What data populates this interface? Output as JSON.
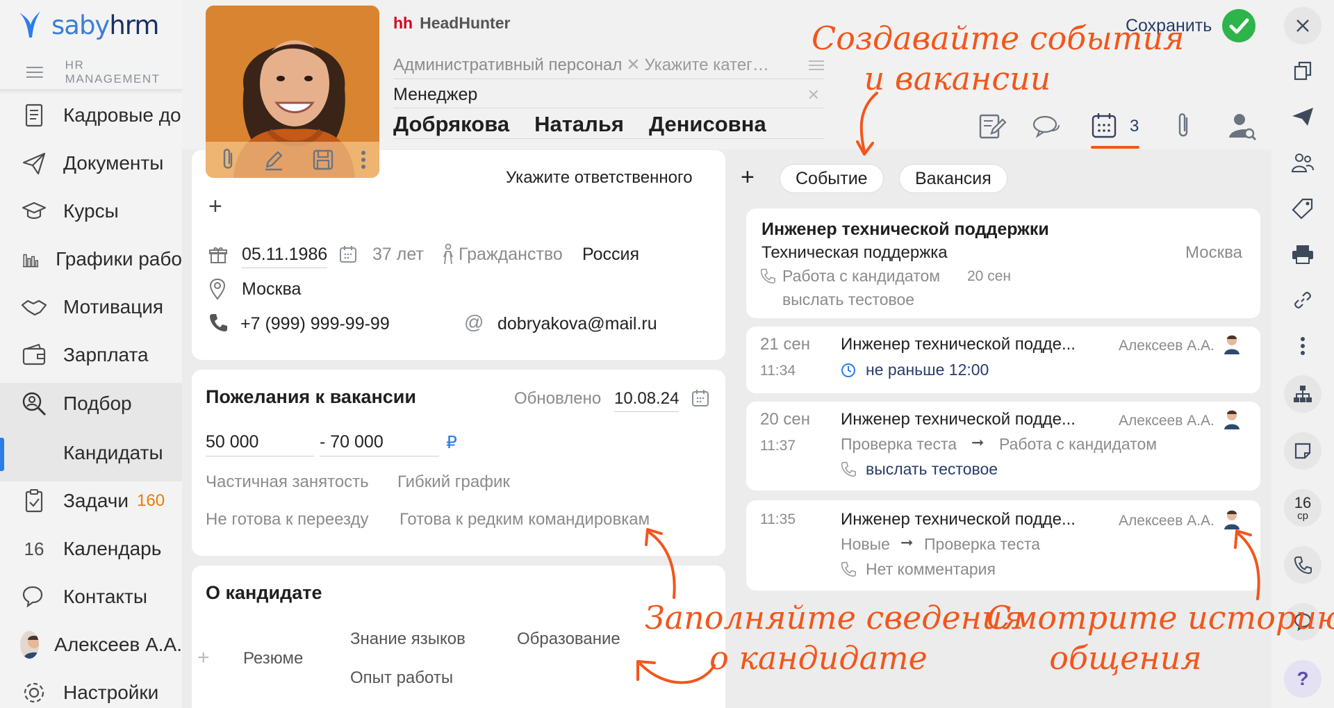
{
  "sidebar": {
    "logo_text_saby": "saby",
    "logo_text_hrm": "hrm",
    "section_label": "HR MANAGEMENT",
    "items": [
      {
        "label": "Кадровые до"
      },
      {
        "label": "Документы"
      },
      {
        "label": "Курсы"
      },
      {
        "label": "Графики рабо"
      },
      {
        "label": "Мотивация"
      },
      {
        "label": "Зарплата"
      },
      {
        "label": "Подбор"
      },
      {
        "label": "Кандидаты"
      },
      {
        "label": "Задачи",
        "badge": "160"
      },
      {
        "label": "Календарь",
        "icon_text": "16"
      },
      {
        "label": "Контакты"
      },
      {
        "label": "Алексеев А.А."
      },
      {
        "label": "Настройки"
      }
    ]
  },
  "candidate": {
    "source_logo": "hh",
    "source_name": "HeadHunter",
    "category": "Административный персонал",
    "category_placeholder": "Укажите катег…",
    "position": "Менеджер",
    "last_name": "Добрякова",
    "first_name": "Наталья",
    "middle_name": "Денисовна",
    "responsible_placeholder": "Укажите ответственного",
    "birth_date": "05.11.1986",
    "age": "37 лет",
    "citizenship_label": "Гражданство",
    "citizenship": "Россия",
    "city": "Москва",
    "phone": "+7 (999) 999-99-99",
    "email": "dobryakova@mail.ru"
  },
  "header": {
    "save_label": "Сохранить",
    "events_count": "3"
  },
  "wishes": {
    "title": "Пожелания к вакансии",
    "updated_label": "Обновлено",
    "updated_date": "10.08.24",
    "salary_from": "50 000",
    "salary_to": "- 70 000",
    "currency": "₽",
    "tags": [
      "Частичная занятость",
      "Гибкий график",
      "Не готова к переезду",
      "Готова к редким командировкам"
    ]
  },
  "about": {
    "title": "О кандидате",
    "links": [
      "Резюме",
      "Знание языков",
      "Образование",
      "Опыт работы"
    ]
  },
  "events": {
    "add_buttons": [
      "Событие",
      "Вакансия"
    ],
    "vacancy_card": {
      "title": "Инженер технической поддержки",
      "department": "Техническая поддержка",
      "city": "Москва",
      "stage": "Работа с кандидатом",
      "stage_date": "20 сен",
      "comment": "выслать тестовое"
    },
    "history": [
      {
        "date": "21 сен",
        "time": "11:34",
        "title": "Инженер технической подде...",
        "author": "Алексеев А.А.",
        "line1": "не раньше 12:00"
      },
      {
        "date": "20 сен",
        "time": "11:37",
        "title": "Инженер технической подде...",
        "author": "Алексеев А.А.",
        "from": "Проверка теста",
        "to": "Работа с кандидатом",
        "line2": "выслать тестовое"
      },
      {
        "date": "",
        "time": "11:35",
        "title": "Инженер технической подде...",
        "author": "Алексеев А.А.",
        "from": "Новые",
        "to": "Проверка теста",
        "line2": "Нет комментария"
      }
    ]
  },
  "rail": {
    "calendar_day": "16",
    "calendar_weekday": "ср",
    "help": "?"
  },
  "annotations": {
    "top_1": "Создавайте события",
    "top_2": "и вакансии",
    "left_1": "Заполняйте сведения",
    "left_2": "о кандидате",
    "right_1": "Смотрите историю",
    "right_2": "общения"
  },
  "colors": {
    "accent": "#f2561c",
    "brand_blue": "#2b7de9",
    "save_green": "#2db44a"
  }
}
